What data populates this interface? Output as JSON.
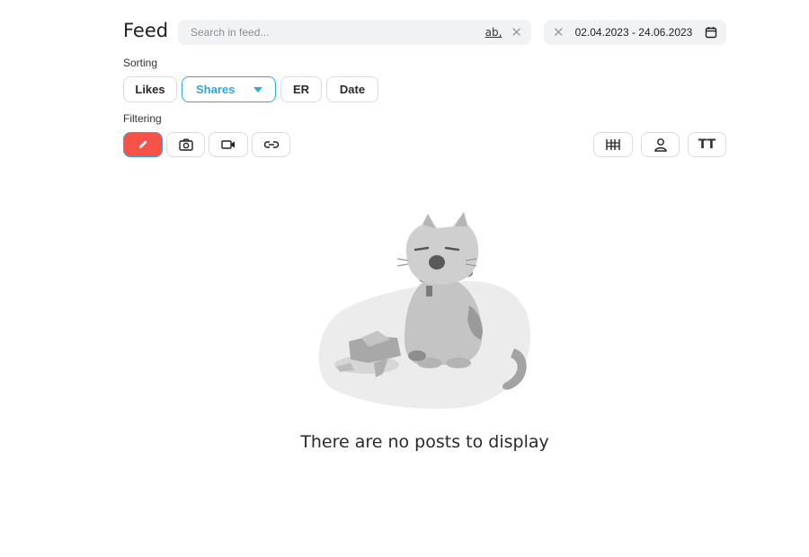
{
  "header": {
    "title": "Feed",
    "search": {
      "placeholder": "Search in feed...",
      "value": "",
      "match_toggle": "ab,"
    },
    "date_range": "02.04.2023 - 24.06.2023"
  },
  "sorting": {
    "label": "Sorting",
    "options": [
      "Likes",
      "Shares",
      "ER",
      "Date"
    ],
    "selected": "Shares"
  },
  "filtering": {
    "label": "Filtering",
    "left_icons": [
      "pencil-icon",
      "camera-icon",
      "video-icon",
      "link-icon"
    ],
    "active": "pencil-icon",
    "right_icons": [
      "columns-icon",
      "person-icon",
      "text-size-icon"
    ],
    "text_size_glyph": "TT"
  },
  "empty_state": {
    "message": "There are no posts to display",
    "illustration": "sad-cat-broken-vase"
  },
  "colors": {
    "accent": "#29a9e6",
    "active_filter": "#f55248",
    "field_bg": "#f1f2f3",
    "border": "#d9dce0"
  }
}
